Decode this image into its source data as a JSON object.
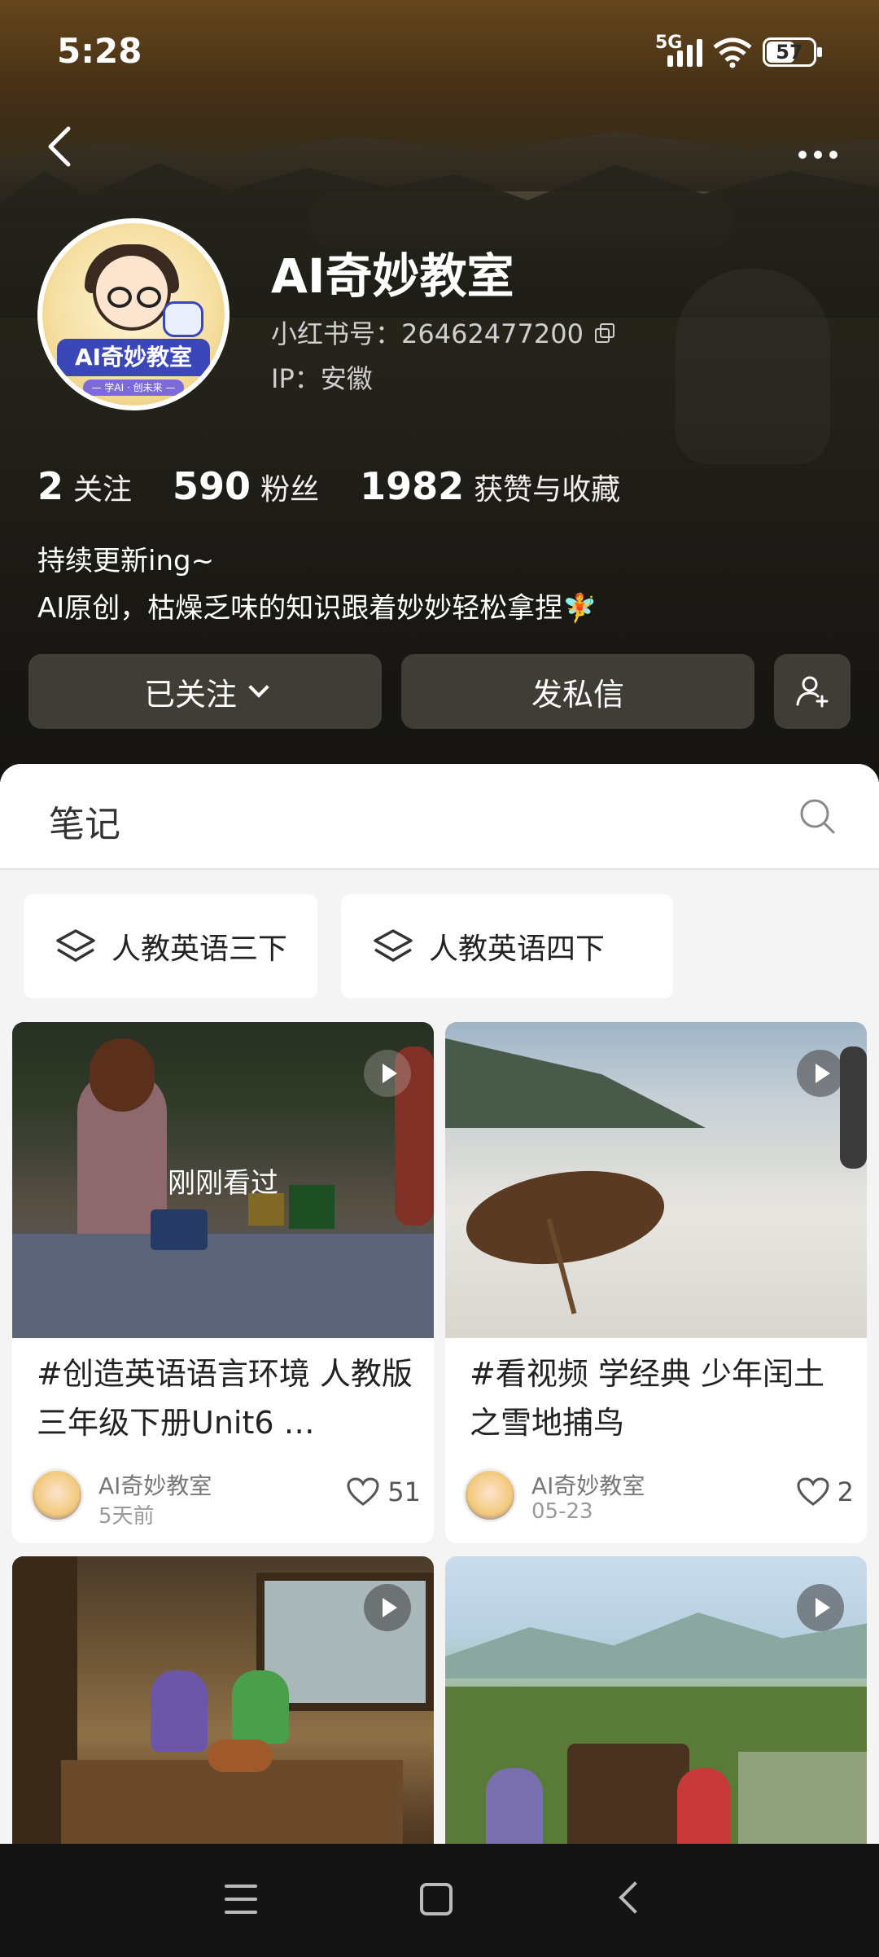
{
  "status_bar": {
    "time": "5:28",
    "network": "5G",
    "battery": "57"
  },
  "profile": {
    "name": "AI奇妙教室",
    "redbook_id": "小红书号：26462477200",
    "ip": "IP：安徽",
    "avatar_text": "AI奇妙教室",
    "avatar_sub": "— 学AI · 创未来 —",
    "stats": [
      {
        "value": "2",
        "label": "关注"
      },
      {
        "value": "590",
        "label": "粉丝"
      },
      {
        "value": "1982",
        "label": "获赞与收藏"
      }
    ],
    "bio_line1": "持续更新ing~",
    "bio_line2": "AI原创，枯燥乏味的知识跟着妙妙轻松拿捏🧚"
  },
  "actions": {
    "follow_label": "已关注",
    "message_label": "发私信"
  },
  "tabs": {
    "notes": "笔记"
  },
  "collections": [
    "人教英语三下",
    "人教英语四下"
  ],
  "notes": [
    {
      "title": "#创造英语语言环境 人教版三年级下册Unit6 …",
      "author": "AI奇妙教室",
      "date": "5天前",
      "likes": "51",
      "overlay": "刚刚看过"
    },
    {
      "title": "#看视频 学经典 少年闰土之雪地捕鸟",
      "author": "AI奇妙教室",
      "date": "05-23",
      "likes": "2"
    }
  ],
  "icons": {
    "back": "back-arrow-icon",
    "more": "more-dots-icon",
    "copy": "copy-icon",
    "add_user": "add-user-icon",
    "search": "search-icon",
    "collection": "layers-icon",
    "play": "play-icon",
    "like": "heart-icon"
  },
  "colors": {
    "accent_dark_button": "#46443c",
    "panel_bg": "#f4f4f4"
  }
}
